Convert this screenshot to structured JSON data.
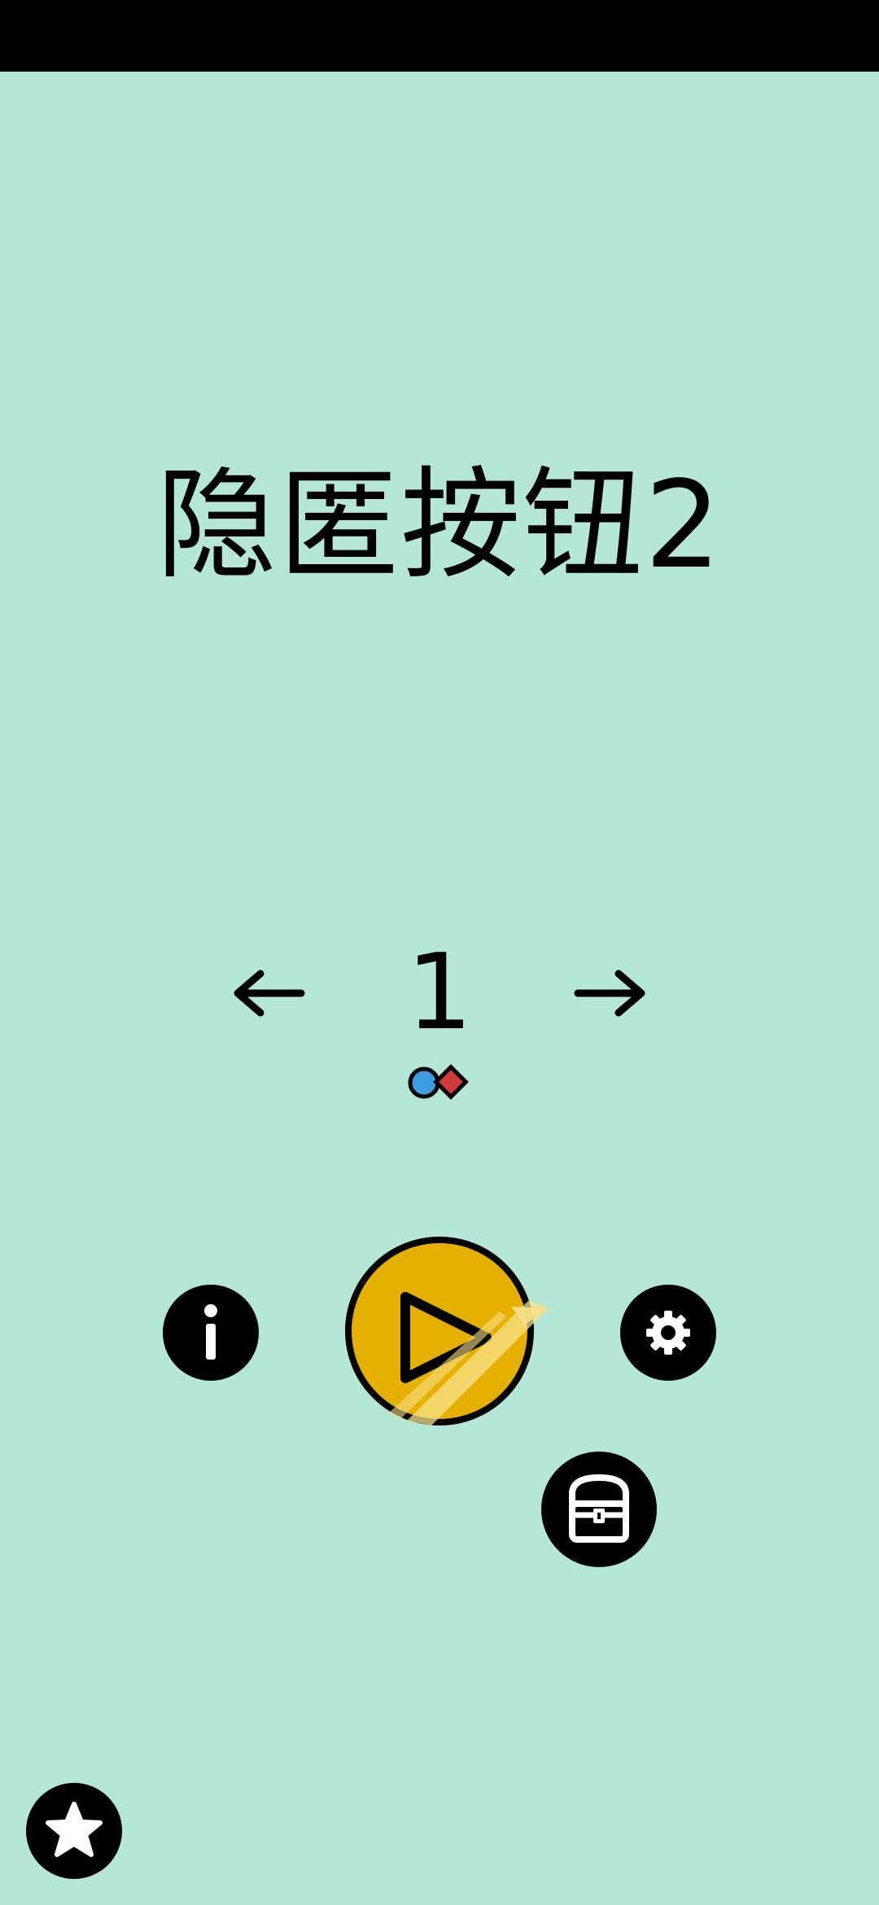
{
  "title": "隐匿按钮2",
  "level_selector": {
    "current_level": "1",
    "prev_label": "←",
    "next_label": "→"
  },
  "level_markers": {
    "circle_color": "#3d9be0",
    "diamond_color": "#d23a3a"
  },
  "buttons": {
    "info_icon": "info-icon",
    "play_icon": "play-icon",
    "settings_icon": "gear-icon",
    "chest_icon": "treasure-chest-icon",
    "star_icon": "star-icon"
  },
  "colors": {
    "background": "#b4e7d5",
    "play_button": "#e5b000",
    "play_shine": "#f7e08a",
    "status_bar": "#000000"
  }
}
